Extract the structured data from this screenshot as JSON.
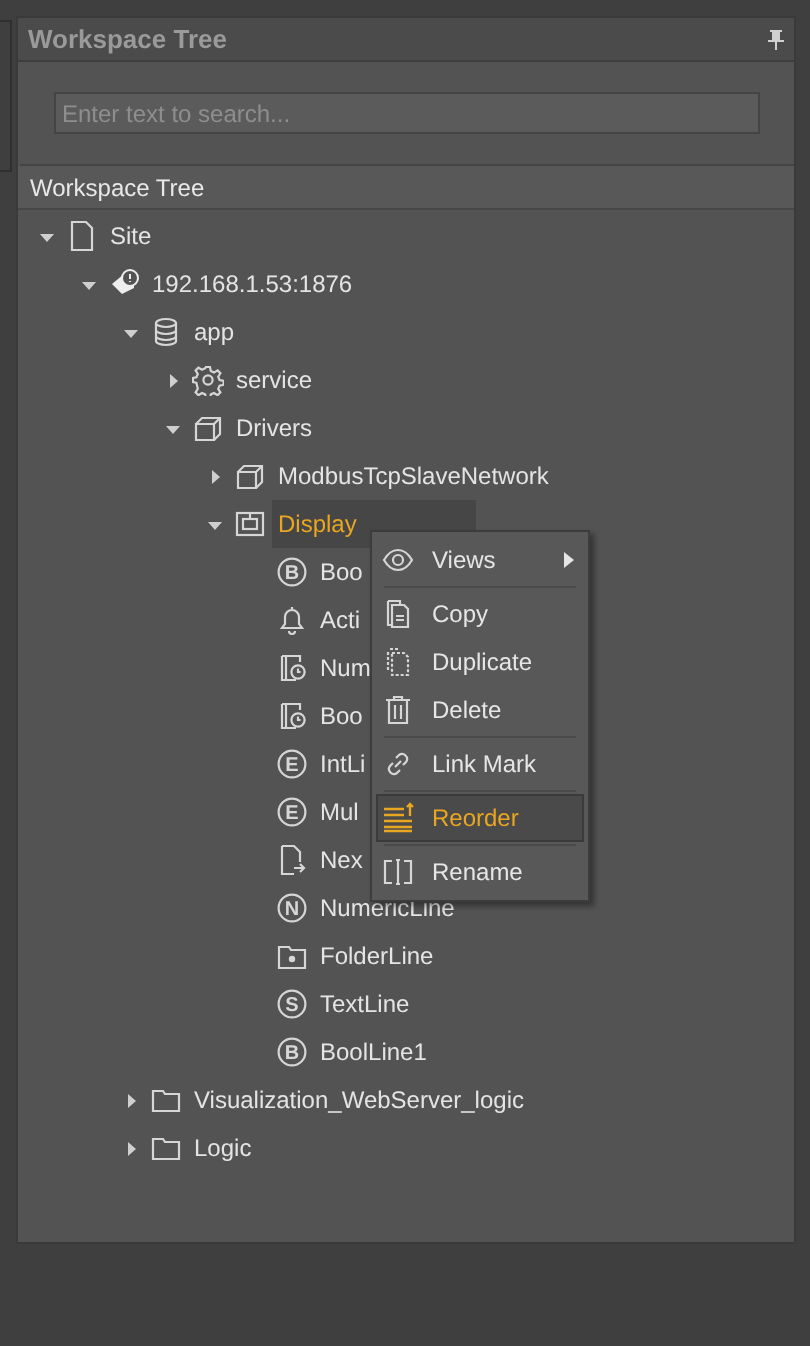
{
  "panel": {
    "title": "Workspace Tree"
  },
  "search": {
    "placeholder": "Enter text to search..."
  },
  "tree_header": "Workspace Tree",
  "tree": [
    {
      "label": "Site",
      "kind": "file",
      "expanded": true,
      "selected": false,
      "children": [
        {
          "label": "192.168.1.53:1876",
          "kind": "server",
          "expanded": true,
          "selected": false,
          "children": [
            {
              "label": "app",
              "kind": "database",
              "expanded": true,
              "selected": false,
              "children": [
                {
                  "label": "service",
                  "kind": "gear",
                  "expanded": false,
                  "selected": false
                },
                {
                  "label": "Drivers",
                  "kind": "driver",
                  "expanded": true,
                  "selected": false,
                  "children": [
                    {
                      "label": "ModbusTcpSlaveNetwork",
                      "kind": "driver",
                      "expanded": false,
                      "selected": false
                    },
                    {
                      "label": "Display",
                      "kind": "display",
                      "expanded": true,
                      "selected": true,
                      "children": [
                        {
                          "label": "Boo",
                          "kind": "letter",
                          "badge": "B",
                          "selected": false
                        },
                        {
                          "label": "Acti",
                          "kind": "bell",
                          "selected": false
                        },
                        {
                          "label": "Num",
                          "kind": "clockdoc",
                          "selected": false
                        },
                        {
                          "label": "Boo",
                          "kind": "clockdoc",
                          "selected": false
                        },
                        {
                          "label": "IntLi",
                          "kind": "letter",
                          "badge": "E",
                          "selected": false
                        },
                        {
                          "label": "Mul",
                          "kind": "letter",
                          "badge": "E",
                          "selected": false
                        },
                        {
                          "label": "Nex",
                          "kind": "docarrow",
                          "selected": false
                        },
                        {
                          "label": "NumericLine",
                          "kind": "letter",
                          "badge": "N",
                          "selected": false
                        },
                        {
                          "label": "FolderLine",
                          "kind": "folderdot",
                          "selected": false
                        },
                        {
                          "label": "TextLine",
                          "kind": "letter",
                          "badge": "S",
                          "selected": false
                        },
                        {
                          "label": "BoolLine1",
                          "kind": "letter",
                          "badge": "B",
                          "selected": false
                        }
                      ]
                    }
                  ]
                }
              ]
            },
            {
              "label": "Visualization_WebServer_logic",
              "kind": "folder",
              "expanded": false,
              "selected": false
            },
            {
              "label": "Logic",
              "kind": "folder",
              "expanded": false,
              "selected": false
            }
          ]
        }
      ]
    }
  ],
  "context_menu": [
    {
      "label": "Views",
      "kind": "eye",
      "submenu": true,
      "selected": false
    },
    {
      "label": "Copy",
      "kind": "copy",
      "submenu": false,
      "selected": false
    },
    {
      "label": "Duplicate",
      "kind": "duplicate",
      "submenu": false,
      "selected": false
    },
    {
      "label": "Delete",
      "kind": "trash",
      "submenu": false,
      "selected": false
    },
    {
      "label": "Link Mark",
      "kind": "link",
      "submenu": false,
      "selected": false
    },
    {
      "label": "Reorder",
      "kind": "reorder",
      "submenu": false,
      "selected": true
    },
    {
      "label": "Rename",
      "kind": "rename",
      "submenu": false,
      "selected": false
    }
  ]
}
